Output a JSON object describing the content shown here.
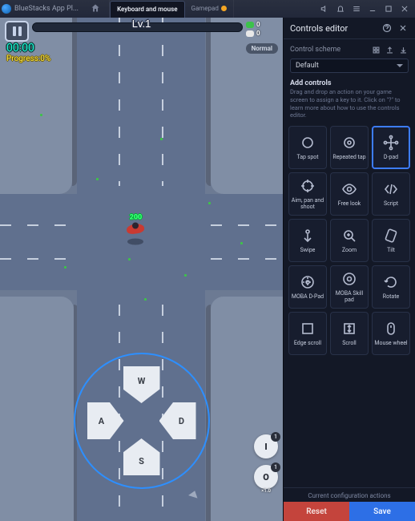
{
  "topbar": {
    "app_name": "BlueStacks App Pl...",
    "tab_home_label": "",
    "tab_kbm": "Keyboard and mouse",
    "tab_gamepad": "Gamepad"
  },
  "hud": {
    "level": "Lv.1",
    "time": "00:00",
    "progress": "Progress:0%",
    "mode": "Normal",
    "stat_coin": "0",
    "stat_skull": "0",
    "player_hp": "200"
  },
  "dpad": {
    "up": "W",
    "down": "S",
    "left": "A",
    "right": "D"
  },
  "float": {
    "one": "I",
    "two": "O",
    "two_sub": "×1.0"
  },
  "panel": {
    "title": "Controls editor",
    "scheme_label": "Control scheme",
    "scheme_value": "Default",
    "add_heading": "Add controls",
    "add_sub": "Drag and drop an action on your game screen to assign a key to it. Click on \"?\" to learn more about how to use the controls editor.",
    "config_line": "Current configuration actions",
    "reset": "Reset",
    "save": "Save"
  },
  "controls": [
    {
      "id": "tap-spot",
      "label": "Tap spot"
    },
    {
      "id": "repeated-tap",
      "label": "Repeated tap"
    },
    {
      "id": "d-pad",
      "label": "D-pad",
      "selected": true
    },
    {
      "id": "aim-pan-shoot",
      "label": "Aim, pan and shoot"
    },
    {
      "id": "free-look",
      "label": "Free look"
    },
    {
      "id": "script",
      "label": "Script"
    },
    {
      "id": "swipe",
      "label": "Swipe"
    },
    {
      "id": "zoom",
      "label": "Zoom"
    },
    {
      "id": "tilt",
      "label": "Tilt"
    },
    {
      "id": "moba-d-pad",
      "label": "MOBA D-Pad"
    },
    {
      "id": "moba-skill-pad",
      "label": "MOBA Skill pad"
    },
    {
      "id": "rotate",
      "label": "Rotate"
    },
    {
      "id": "edge-scroll",
      "label": "Edge scroll"
    },
    {
      "id": "scroll",
      "label": "Scroll"
    },
    {
      "id": "mouse-wheel",
      "label": "Mouse wheel"
    }
  ]
}
